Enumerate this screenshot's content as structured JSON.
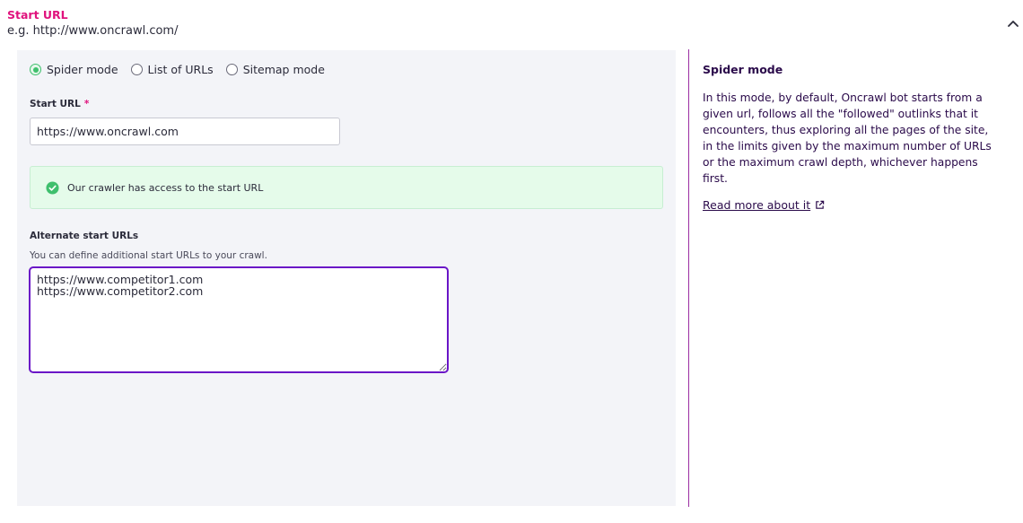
{
  "section": {
    "title": "Start URL",
    "example": "e.g. http://www.oncrawl.com/"
  },
  "modes": [
    {
      "label": "Spider mode",
      "checked": true
    },
    {
      "label": "List of URLs",
      "checked": false
    },
    {
      "label": "Sitemap mode",
      "checked": false
    }
  ],
  "start_url": {
    "label": "Start URL",
    "required_mark": "*",
    "value": "https://www.oncrawl.com"
  },
  "alert": {
    "text": "Our crawler has access to the start URL",
    "color": "#3fbf6d"
  },
  "alternate": {
    "label": "Alternate start URLs",
    "help": "You can define additional start URLs to your crawl.",
    "value": "https://www.competitor1.com\nhttps://www.competitor2.com"
  },
  "aside": {
    "title": "Spider mode",
    "body": "In this mode, by default, Oncrawl bot starts from a given url, follows all the \"followed\" outlinks that it encounters, thus exploring all the pages of the site, in the limits given by the maximum number of URLs or the maximum crawl depth, whichever happens first.",
    "link": "Read more about it"
  },
  "icons": {
    "collapse": "chevron-up-icon",
    "success": "check-circle-icon",
    "external": "external-link-icon"
  },
  "colors": {
    "accent": "#e0127d",
    "focus": "#6a16c7",
    "divider": "#9b2fa3"
  }
}
